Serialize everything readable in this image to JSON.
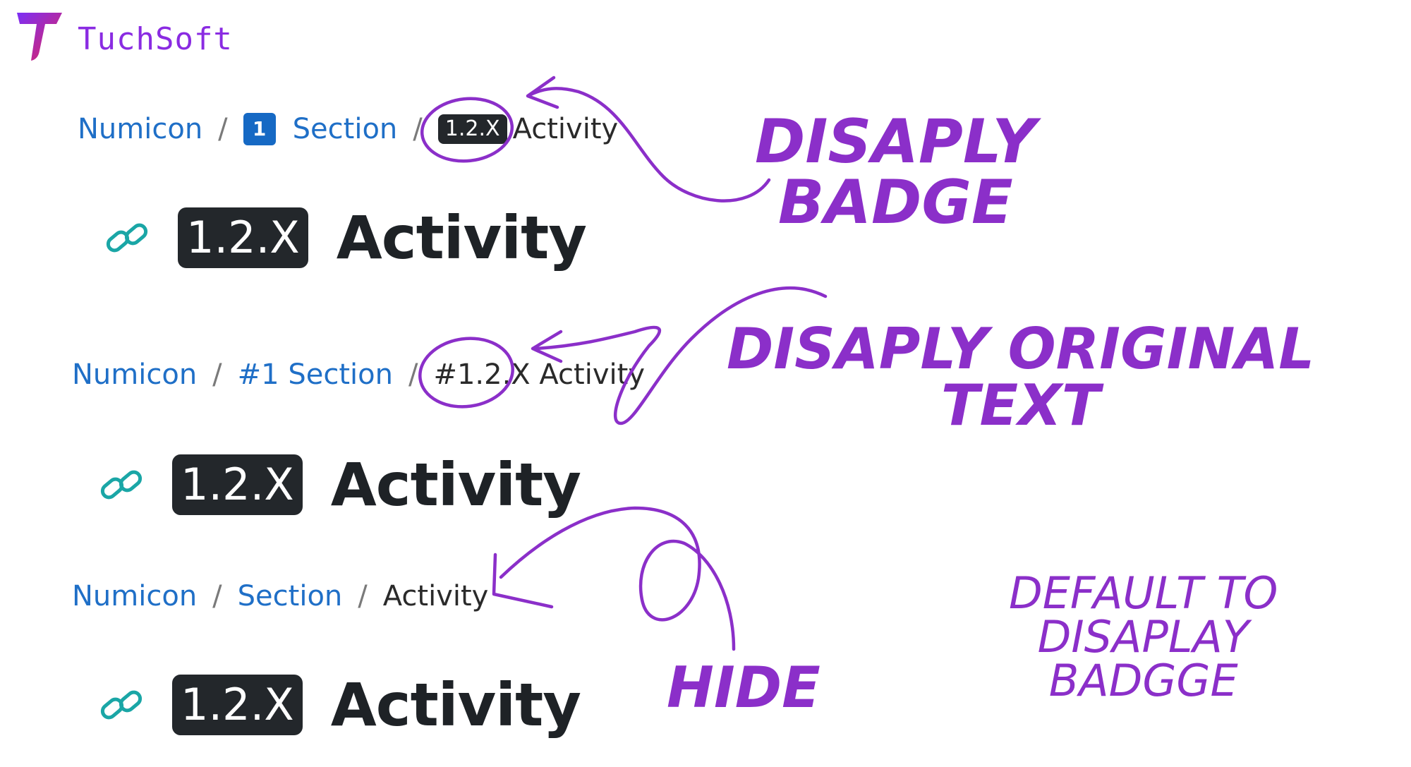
{
  "logo": {
    "text": "TuchSoft"
  },
  "colors": {
    "link": "#1f6fc7",
    "badge_dark": "#23272b",
    "badge_blue": "#1669c4",
    "annotation": "#8b2fc9",
    "link_icon": "#1aa6a6"
  },
  "examples": [
    {
      "breadcrumb": {
        "items": [
          {
            "label": "Numicon"
          },
          {
            "badge": "1",
            "label": "Section"
          }
        ],
        "separator": "/",
        "current": {
          "badge": "1.2.X",
          "label": "Activity"
        }
      },
      "heading": {
        "icon": "link-icon",
        "badge": "1.2.X",
        "title": "Activity"
      }
    },
    {
      "breadcrumb": {
        "items": [
          {
            "label": "Numicon"
          },
          {
            "label": "#1 Section"
          }
        ],
        "separator": "/",
        "current": {
          "label": "#1.2.X Activity"
        }
      },
      "heading": {
        "icon": "link-icon",
        "badge": "1.2.X",
        "title": "Activity"
      }
    },
    {
      "breadcrumb": {
        "items": [
          {
            "label": "Numicon"
          },
          {
            "label": "Section"
          }
        ],
        "separator": "/",
        "current": {
          "label": "Activity"
        }
      },
      "heading": {
        "icon": "link-icon",
        "badge": "1.2.X",
        "title": "Activity"
      }
    }
  ],
  "annotations": {
    "display_badge": [
      "DISAPLY",
      "BADGE"
    ],
    "display_original": [
      "DISAPLY ORIGINAL",
      "TEXT"
    ],
    "hide": "HIDE",
    "default": [
      "DEFAULT TO",
      "DISAPLAY",
      "BADGGE"
    ]
  }
}
